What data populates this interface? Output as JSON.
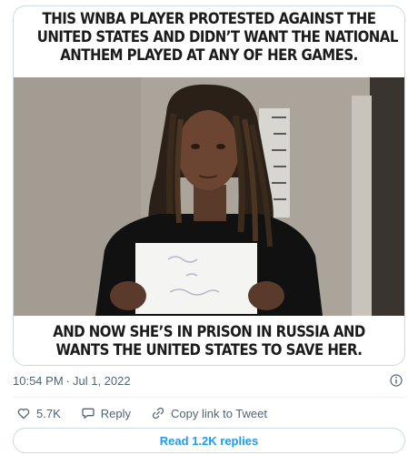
{
  "meme": {
    "top_lines": [
      "THIS WNBA PLAYER PROTESTED AGAINST THE",
      "UNITED STATES AND DIDN’T WANT THE NATIONAL",
      "ANTHEM PLAYED AT ANY OF HER GAMES."
    ],
    "bottom_lines": [
      "AND NOW SHE’S IN PRISON IN RUSSIA AND",
      "WANTS THE UNITED STATES TO SAVE HER."
    ]
  },
  "tweet": {
    "time": "10:54 PM",
    "separator": "·",
    "date": "Jul 1, 2022"
  },
  "actions": {
    "likes_count": "5.7K",
    "reply_label": "Reply",
    "copy_link_label": "Copy link to Tweet"
  },
  "replies_button_label": "Read 1.2K replies",
  "colors": {
    "link_blue": "#1d9bf0",
    "secondary_text": "#536471",
    "border": "#cfd9de"
  }
}
